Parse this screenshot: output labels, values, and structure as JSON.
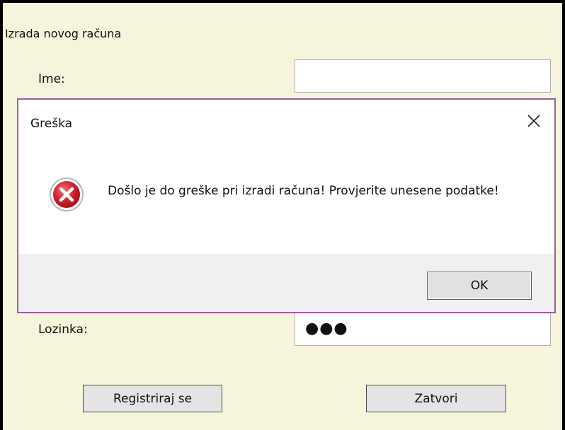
{
  "form": {
    "title": "Izrada novog računa",
    "name_label": "Ime:",
    "name_value": "",
    "password_label": "Lozinka:",
    "password_mask": "●●●",
    "register_button": "Registriraj se",
    "close_button": "Zatvori"
  },
  "dialog": {
    "title": "Greška",
    "close_glyph": "✕",
    "message": "Došlo je do greške pri izradi računa! Provjerite unesene podatke!",
    "ok_button": "OK",
    "icon": "error-icon"
  },
  "colors": {
    "form_background": "#f6f5dc",
    "dialog_border": "#a35aa3",
    "error_red": "#c8141e"
  }
}
